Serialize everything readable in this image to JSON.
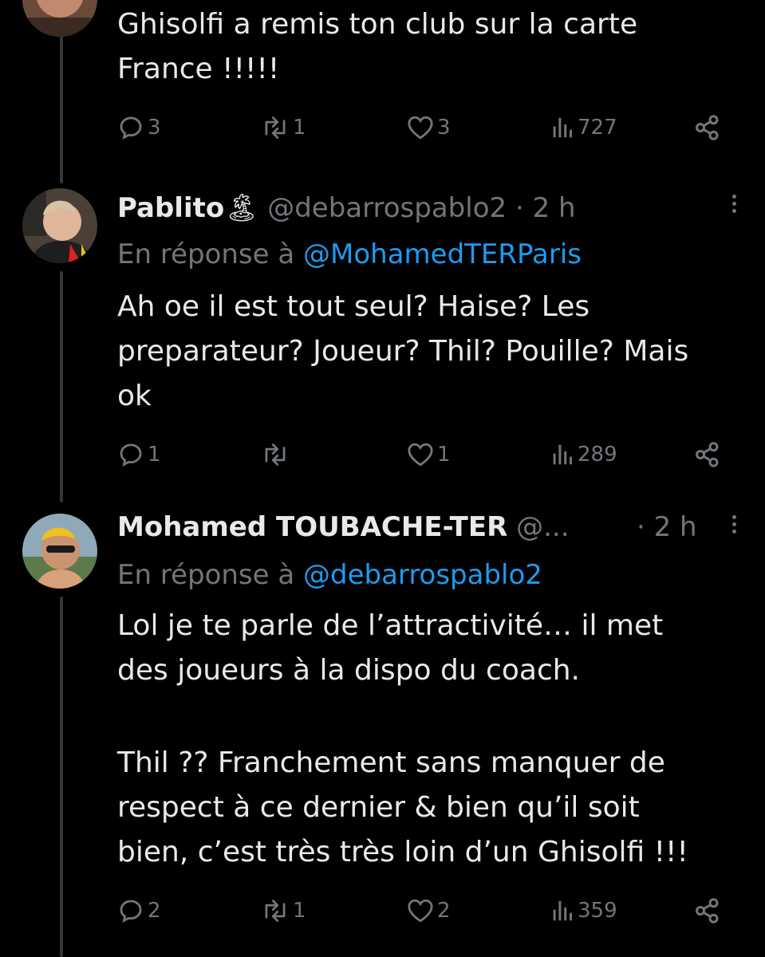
{
  "tweets": [
    {
      "text_lines": [
        "Ghisolfi a remis ton club sur la carte",
        "France !!!!!"
      ],
      "actions": {
        "replies": "3",
        "reposts": "1",
        "likes": "3",
        "views": "727"
      }
    },
    {
      "name": "Pablito",
      "name_emoji": "🏝",
      "handle": "@debarrospablo2",
      "time": "· 2 h",
      "reply_prefix": "En réponse à",
      "reply_to": "@MohamedTERParis",
      "text_lines": [
        "Ah oe il est tout seul? Haise? Les",
        "preparateur? Joueur? Thil? Pouille? Mais",
        "ok"
      ],
      "actions": {
        "replies": "1",
        "reposts": "",
        "likes": "1",
        "views": "289"
      }
    },
    {
      "name": "Mohamed TOUBACHE-TER",
      "handle": "@...",
      "time": "· 2 h",
      "reply_prefix": "En réponse à",
      "reply_to": "@debarrospablo2",
      "text_lines": [
        "Lol je te parle de l’attractivité… il met",
        "des joueurs à la dispo du coach.",
        "",
        "Thil ?? Franchement sans manquer de",
        "respect à ce dernier & bien qu’il soit",
        "bien, c’est très très loin d’un Ghisolfi !!!"
      ],
      "actions": {
        "replies": "2",
        "reposts": "1",
        "likes": "2",
        "views": "359"
      }
    }
  ],
  "colors": {
    "background": "#000000",
    "text": "#e7e9ea",
    "muted": "#71767b",
    "mention": "#1d9bf0",
    "thread": "#333639"
  },
  "icons": [
    "reply-icon",
    "repost-icon",
    "like-icon",
    "views-icon",
    "share-icon",
    "more-icon"
  ]
}
